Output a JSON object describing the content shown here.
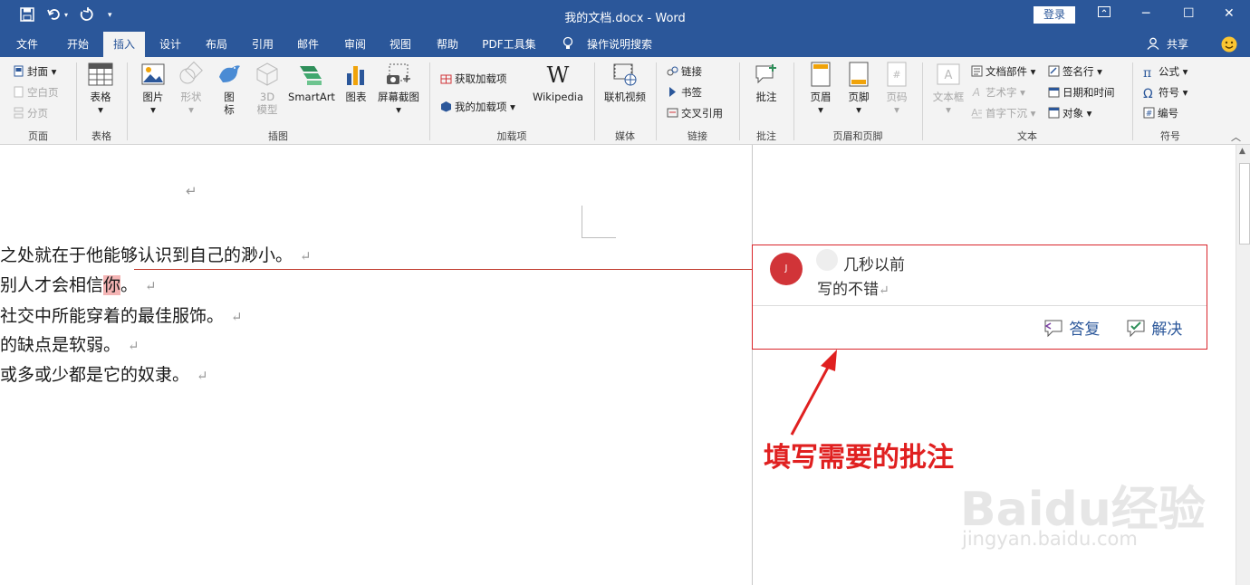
{
  "titlebar": {
    "title": "我的文档.docx - Word",
    "login": "登录"
  },
  "tabs": [
    "文件",
    "开始",
    "插入",
    "设计",
    "布局",
    "引用",
    "邮件",
    "审阅",
    "视图",
    "帮助",
    "PDF工具集",
    "操作说明搜索"
  ],
  "share": "共享",
  "ribbon": {
    "page": {
      "cover": "封面",
      "blank": "空白页",
      "break": "分页",
      "label": "页面"
    },
    "table": {
      "btn": "表格",
      "label": "表格"
    },
    "illustrations": {
      "picture": "图片",
      "shapes": "形状",
      "icons1": "图",
      "icons2": "标",
      "model1": "3D",
      "model2": "模型",
      "smartart": "SmartArt",
      "chart": "图表",
      "screenshot": "屏幕截图",
      "label": "插图"
    },
    "addins": {
      "get": "获取加载项",
      "my": "我的加载项",
      "wiki": "Wikipedia",
      "label": "加载项"
    },
    "media": {
      "video": "联机视频",
      "label": "媒体"
    },
    "links": {
      "link": "链接",
      "bookmark": "书签",
      "crossref": "交叉引用",
      "label": "链接"
    },
    "comments": {
      "btn": "批注",
      "label": "批注"
    },
    "headerfooter": {
      "header": "页眉",
      "footer": "页脚",
      "pagenum": "页码",
      "label": "页眉和页脚"
    },
    "text": {
      "textbox": "文本框",
      "docparts": "文档部件",
      "wordart": "艺术字",
      "dropcap": "首字下沉",
      "signature": "签名行",
      "datetime": "日期和时间",
      "object": "对象",
      "label": "文本"
    },
    "symbols": {
      "equation": "公式",
      "symbol": "符号",
      "number": "编号",
      "label": "符号"
    }
  },
  "document": {
    "lines": [
      {
        "text": "之处就在于他能够认识到自己的渺小。"
      },
      {
        "pre": "别人才会相信",
        "hl": "你",
        "post": "。"
      },
      {
        "text": "社交中所能穿着的最佳服饰。"
      },
      {
        "text": "的缺点是软弱。"
      },
      {
        "text": "或多或少都是它的奴隶。"
      }
    ],
    "mark": "↵"
  },
  "comment": {
    "avatar": "J",
    "time": "几秒以前",
    "text": "写的不错",
    "reply": "答复",
    "resolve": "解决"
  },
  "annotation": "填写需要的批注",
  "watermark": {
    "brand": "Baidu经验",
    "url": "jingyan.baidu.com"
  }
}
